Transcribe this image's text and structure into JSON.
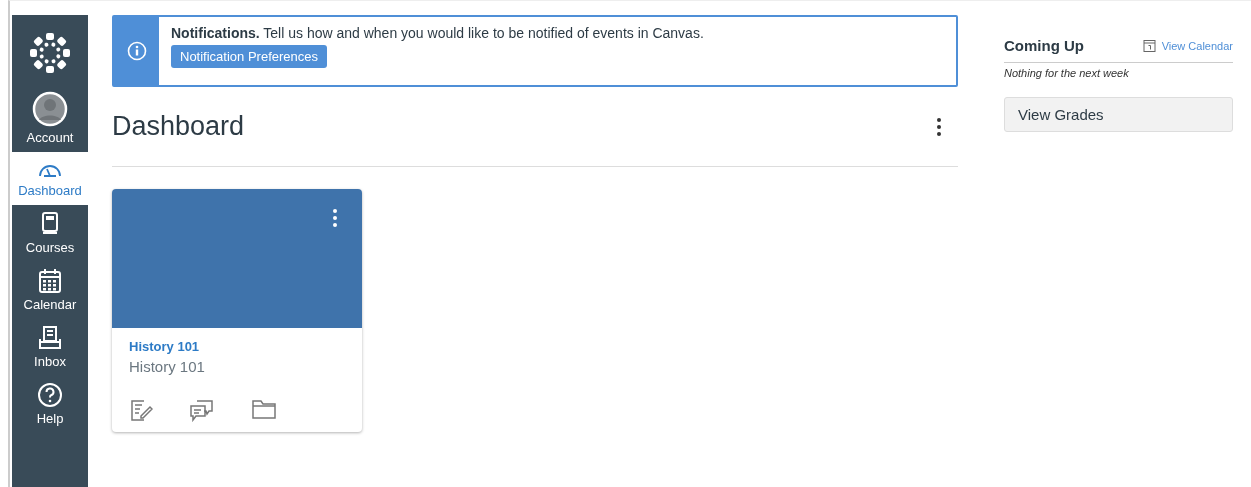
{
  "nav": [
    {
      "kind": "account",
      "label": "Account",
      "selected": false
    },
    {
      "kind": "dashboard",
      "label": "Dashboard",
      "selected": true
    },
    {
      "kind": "courses",
      "label": "Courses",
      "selected": false
    },
    {
      "kind": "calendar",
      "label": "Calendar",
      "selected": false
    },
    {
      "kind": "inbox",
      "label": "Inbox",
      "selected": false
    },
    {
      "kind": "help",
      "label": "Help",
      "selected": false
    }
  ],
  "notification": {
    "title": "Notifications.",
    "text": "Tell us how and when you would like to be notified of events in Canvas.",
    "button": "Notification Preferences"
  },
  "page_title": "Dashboard",
  "cards": [
    {
      "link": "History 101",
      "subtitle": "History 101",
      "color": "#3f73ab"
    }
  ],
  "coming_up": {
    "title": "Coming Up",
    "link": "View Calendar",
    "empty": "Nothing for the next week",
    "button": "View Grades"
  }
}
